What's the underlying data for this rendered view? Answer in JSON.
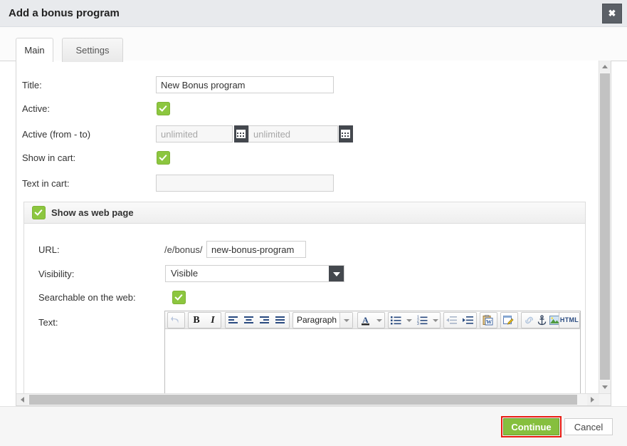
{
  "dialog": {
    "title": "Add a bonus program",
    "close_label": "✖"
  },
  "tabs": [
    {
      "label": "Main",
      "active": true
    },
    {
      "label": "Settings",
      "active": false
    }
  ],
  "form": {
    "title_label": "Title:",
    "title_value": "New Bonus program",
    "active_label": "Active:",
    "active_checked": true,
    "active_range_label": "Active (from - to)",
    "date_from_placeholder": "unlimited",
    "date_to_placeholder": "unlimited",
    "show_in_cart_label": "Show in cart:",
    "show_in_cart_checked": true,
    "text_in_cart_label": "Text in cart:",
    "text_in_cart_value": ""
  },
  "webpage": {
    "header_label": "Show as web page",
    "header_checked": true,
    "url_label": "URL:",
    "url_prefix": "/e/bonus/",
    "url_value": "new-bonus-program",
    "visibility_label": "Visibility:",
    "visibility_value": "Visible",
    "visibility_options": [
      "Visible"
    ],
    "searchable_label": "Searchable on the web:",
    "searchable_checked": true,
    "text_label": "Text:"
  },
  "editor": {
    "format_value": "Paragraph",
    "html_label": "HTML",
    "bold_label": "B",
    "italic_label": "I",
    "content": "",
    "buttons": [
      "undo-icon",
      "bold-icon",
      "italic-icon",
      "align-left-icon",
      "align-center-icon",
      "align-right-icon",
      "align-justify-icon",
      "format-select",
      "text-color-icon",
      "bullet-list-icon",
      "numbered-list-icon",
      "outdent-icon",
      "indent-icon",
      "paste-from-word-icon",
      "edit-source-icon",
      "link-icon",
      "anchor-icon",
      "insert-image-icon",
      "insert-youtube-icon",
      "html-source-button"
    ]
  },
  "footer": {
    "continue_label": "Continue",
    "cancel_label": "Cancel"
  },
  "colors": {
    "accent_green": "#8cc63f",
    "highlight_red": "#e81b11",
    "header_bg": "#e8eaed",
    "dark_button": "#44484e"
  }
}
